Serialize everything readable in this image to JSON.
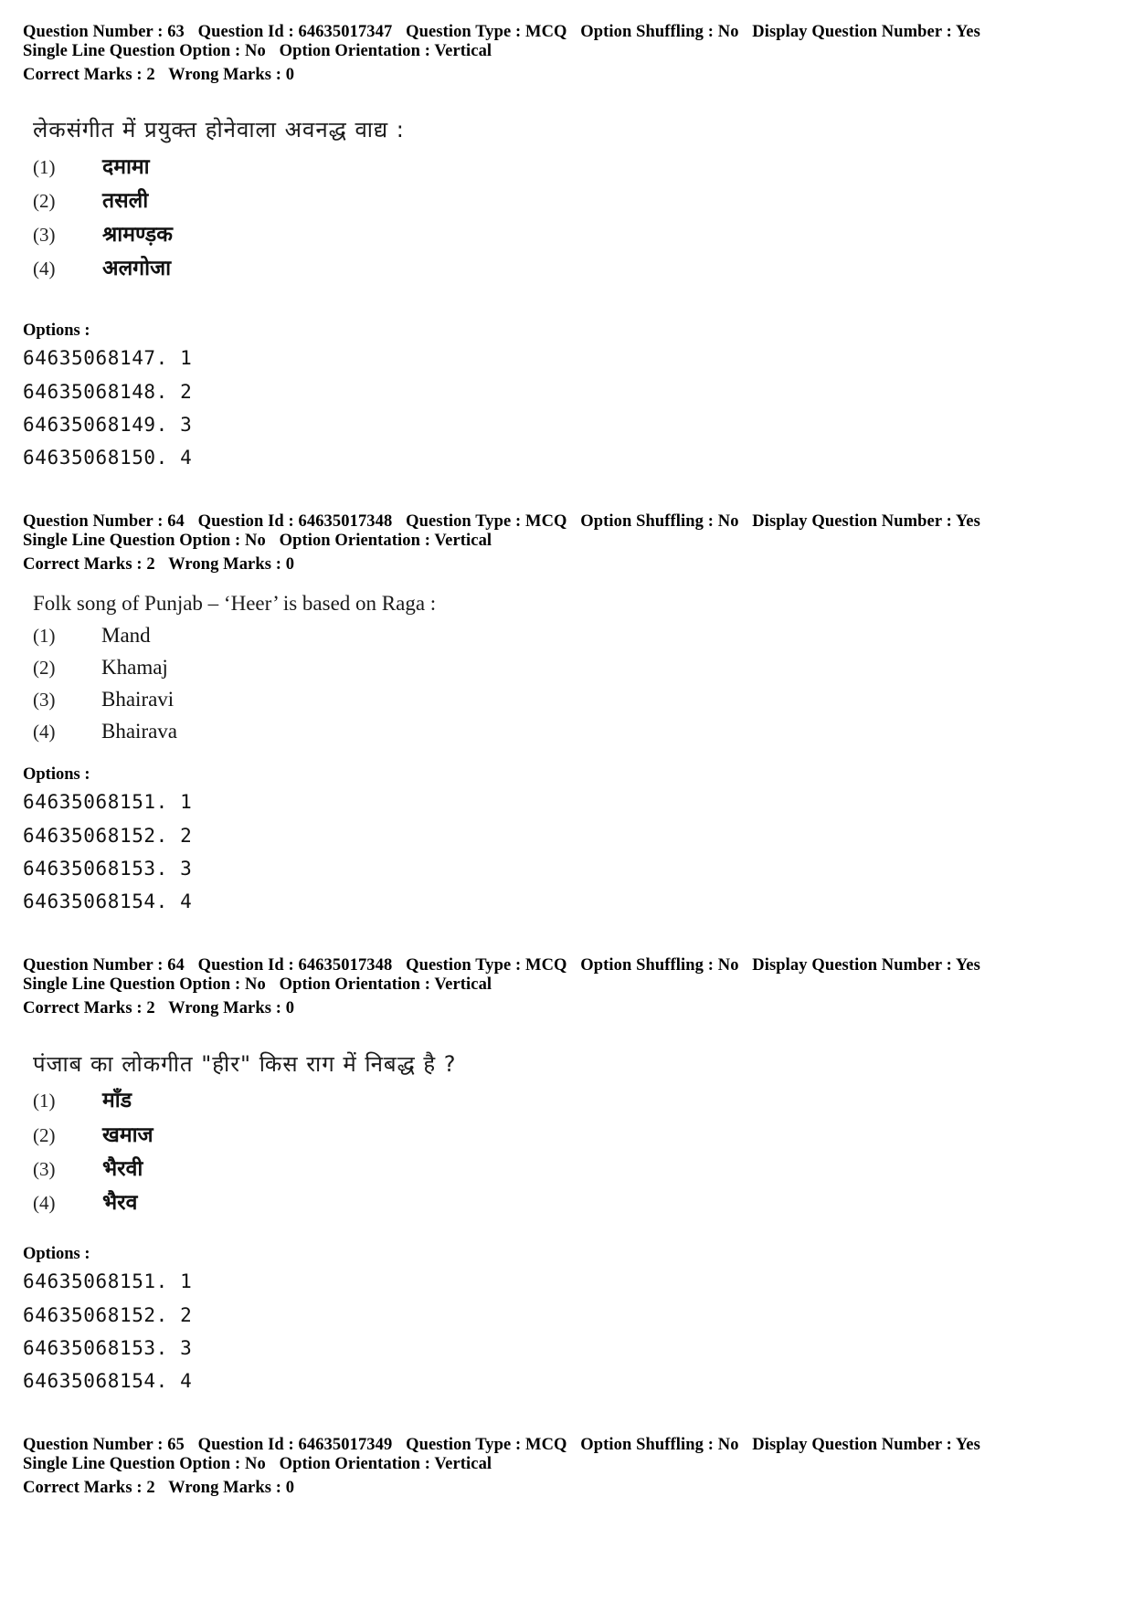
{
  "questions": [
    {
      "meta_line1": [
        "Question Number : 63",
        "Question Id : 64635017347",
        "Question Type : MCQ",
        "Option Shuffling : No",
        "Display Question Number : Yes"
      ],
      "meta_line2": [
        "Single Line Question Option : No",
        "Option Orientation : Vertical"
      ],
      "marks": [
        "Correct Marks : 2",
        "Wrong Marks : 0"
      ],
      "question_text": "लेकसंगीत में प्रयुक्त होनेवाला अवनद्ध वाद्य :",
      "language": "hi",
      "options": [
        {
          "num": "(1)",
          "text": "दमामा"
        },
        {
          "num": "(2)",
          "text": "तसली"
        },
        {
          "num": "(3)",
          "text": "श्रामण्ड़क"
        },
        {
          "num": "(4)",
          "text": "अलगोजा"
        }
      ],
      "options_label": "Options :",
      "choice_ids": [
        "64635068147. 1",
        "64635068148. 2",
        "64635068149. 3",
        "64635068150. 4"
      ]
    },
    {
      "meta_line1": [
        "Question Number : 64",
        "Question Id : 64635017348",
        "Question Type : MCQ",
        "Option Shuffling : No",
        "Display Question Number : Yes"
      ],
      "meta_line2": [
        "Single Line Question Option : No",
        "Option Orientation : Vertical"
      ],
      "marks": [
        "Correct Marks : 2",
        "Wrong Marks : 0"
      ],
      "question_text": "Folk song of Punjab – ‘Heer’ is based on Raga :",
      "language": "en",
      "options": [
        {
          "num": "(1)",
          "text": "Mand"
        },
        {
          "num": "(2)",
          "text": "Khamaj"
        },
        {
          "num": "(3)",
          "text": "Bhairavi"
        },
        {
          "num": "(4)",
          "text": "Bhairava"
        }
      ],
      "options_label": "Options :",
      "choice_ids": [
        "64635068151. 1",
        "64635068152. 2",
        "64635068153. 3",
        "64635068154. 4"
      ]
    },
    {
      "meta_line1": [
        "Question Number : 64",
        "Question Id : 64635017348",
        "Question Type : MCQ",
        "Option Shuffling : No",
        "Display Question Number : Yes"
      ],
      "meta_line2": [
        "Single Line Question Option : No",
        "Option Orientation : Vertical"
      ],
      "marks": [
        "Correct Marks : 2",
        "Wrong Marks : 0"
      ],
      "question_text": "पंजाब का लोकगीत \"हीर\" किस राग में निबद्ध है ?",
      "language": "hi",
      "options": [
        {
          "num": "(1)",
          "text": "माँड"
        },
        {
          "num": "(2)",
          "text": "खमाज"
        },
        {
          "num": "(3)",
          "text": "भैरवी"
        },
        {
          "num": "(4)",
          "text": "भैरव"
        }
      ],
      "options_label": "Options :",
      "choice_ids": [
        "64635068151. 1",
        "64635068152. 2",
        "64635068153. 3",
        "64635068154. 4"
      ]
    },
    {
      "meta_line1": [
        "Question Number : 65",
        "Question Id : 64635017349",
        "Question Type : MCQ",
        "Option Shuffling : No",
        "Display Question Number : Yes"
      ],
      "meta_line2": [
        "Single Line Question Option : No",
        "Option Orientation : Vertical"
      ],
      "marks": [
        "Correct Marks : 2",
        "Wrong Marks : 0"
      ]
    }
  ]
}
